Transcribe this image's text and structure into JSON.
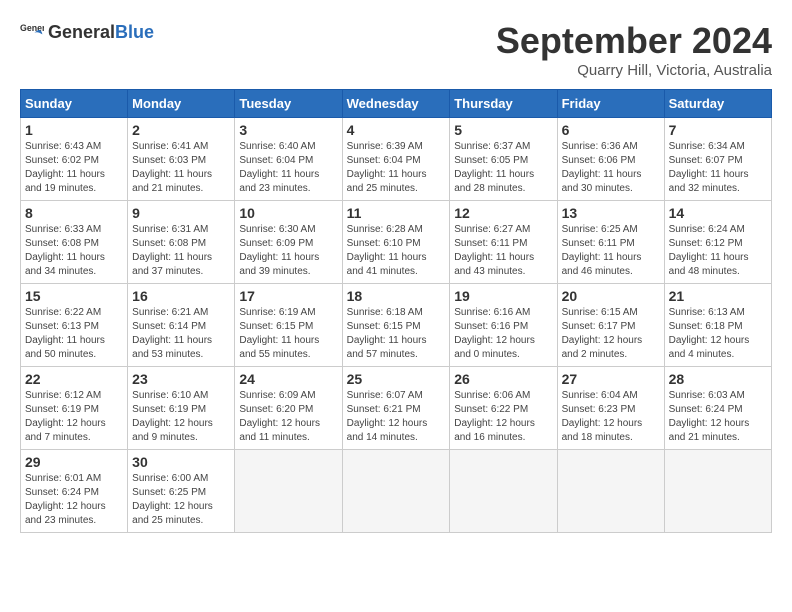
{
  "header": {
    "logo_general": "General",
    "logo_blue": "Blue",
    "month": "September 2024",
    "location": "Quarry Hill, Victoria, Australia"
  },
  "weekdays": [
    "Sunday",
    "Monday",
    "Tuesday",
    "Wednesday",
    "Thursday",
    "Friday",
    "Saturday"
  ],
  "weeks": [
    [
      {
        "day": "1",
        "info": "Sunrise: 6:43 AM\nSunset: 6:02 PM\nDaylight: 11 hours\nand 19 minutes."
      },
      {
        "day": "2",
        "info": "Sunrise: 6:41 AM\nSunset: 6:03 PM\nDaylight: 11 hours\nand 21 minutes."
      },
      {
        "day": "3",
        "info": "Sunrise: 6:40 AM\nSunset: 6:04 PM\nDaylight: 11 hours\nand 23 minutes."
      },
      {
        "day": "4",
        "info": "Sunrise: 6:39 AM\nSunset: 6:04 PM\nDaylight: 11 hours\nand 25 minutes."
      },
      {
        "day": "5",
        "info": "Sunrise: 6:37 AM\nSunset: 6:05 PM\nDaylight: 11 hours\nand 28 minutes."
      },
      {
        "day": "6",
        "info": "Sunrise: 6:36 AM\nSunset: 6:06 PM\nDaylight: 11 hours\nand 30 minutes."
      },
      {
        "day": "7",
        "info": "Sunrise: 6:34 AM\nSunset: 6:07 PM\nDaylight: 11 hours\nand 32 minutes."
      }
    ],
    [
      {
        "day": "8",
        "info": "Sunrise: 6:33 AM\nSunset: 6:08 PM\nDaylight: 11 hours\nand 34 minutes."
      },
      {
        "day": "9",
        "info": "Sunrise: 6:31 AM\nSunset: 6:08 PM\nDaylight: 11 hours\nand 37 minutes."
      },
      {
        "day": "10",
        "info": "Sunrise: 6:30 AM\nSunset: 6:09 PM\nDaylight: 11 hours\nand 39 minutes."
      },
      {
        "day": "11",
        "info": "Sunrise: 6:28 AM\nSunset: 6:10 PM\nDaylight: 11 hours\nand 41 minutes."
      },
      {
        "day": "12",
        "info": "Sunrise: 6:27 AM\nSunset: 6:11 PM\nDaylight: 11 hours\nand 43 minutes."
      },
      {
        "day": "13",
        "info": "Sunrise: 6:25 AM\nSunset: 6:11 PM\nDaylight: 11 hours\nand 46 minutes."
      },
      {
        "day": "14",
        "info": "Sunrise: 6:24 AM\nSunset: 6:12 PM\nDaylight: 11 hours\nand 48 minutes."
      }
    ],
    [
      {
        "day": "15",
        "info": "Sunrise: 6:22 AM\nSunset: 6:13 PM\nDaylight: 11 hours\nand 50 minutes."
      },
      {
        "day": "16",
        "info": "Sunrise: 6:21 AM\nSunset: 6:14 PM\nDaylight: 11 hours\nand 53 minutes."
      },
      {
        "day": "17",
        "info": "Sunrise: 6:19 AM\nSunset: 6:15 PM\nDaylight: 11 hours\nand 55 minutes."
      },
      {
        "day": "18",
        "info": "Sunrise: 6:18 AM\nSunset: 6:15 PM\nDaylight: 11 hours\nand 57 minutes."
      },
      {
        "day": "19",
        "info": "Sunrise: 6:16 AM\nSunset: 6:16 PM\nDaylight: 12 hours\nand 0 minutes."
      },
      {
        "day": "20",
        "info": "Sunrise: 6:15 AM\nSunset: 6:17 PM\nDaylight: 12 hours\nand 2 minutes."
      },
      {
        "day": "21",
        "info": "Sunrise: 6:13 AM\nSunset: 6:18 PM\nDaylight: 12 hours\nand 4 minutes."
      }
    ],
    [
      {
        "day": "22",
        "info": "Sunrise: 6:12 AM\nSunset: 6:19 PM\nDaylight: 12 hours\nand 7 minutes."
      },
      {
        "day": "23",
        "info": "Sunrise: 6:10 AM\nSunset: 6:19 PM\nDaylight: 12 hours\nand 9 minutes."
      },
      {
        "day": "24",
        "info": "Sunrise: 6:09 AM\nSunset: 6:20 PM\nDaylight: 12 hours\nand 11 minutes."
      },
      {
        "day": "25",
        "info": "Sunrise: 6:07 AM\nSunset: 6:21 PM\nDaylight: 12 hours\nand 14 minutes."
      },
      {
        "day": "26",
        "info": "Sunrise: 6:06 AM\nSunset: 6:22 PM\nDaylight: 12 hours\nand 16 minutes."
      },
      {
        "day": "27",
        "info": "Sunrise: 6:04 AM\nSunset: 6:23 PM\nDaylight: 12 hours\nand 18 minutes."
      },
      {
        "day": "28",
        "info": "Sunrise: 6:03 AM\nSunset: 6:24 PM\nDaylight: 12 hours\nand 21 minutes."
      }
    ],
    [
      {
        "day": "29",
        "info": "Sunrise: 6:01 AM\nSunset: 6:24 PM\nDaylight: 12 hours\nand 23 minutes."
      },
      {
        "day": "30",
        "info": "Sunrise: 6:00 AM\nSunset: 6:25 PM\nDaylight: 12 hours\nand 25 minutes."
      },
      {
        "day": "",
        "info": ""
      },
      {
        "day": "",
        "info": ""
      },
      {
        "day": "",
        "info": ""
      },
      {
        "day": "",
        "info": ""
      },
      {
        "day": "",
        "info": ""
      }
    ]
  ]
}
